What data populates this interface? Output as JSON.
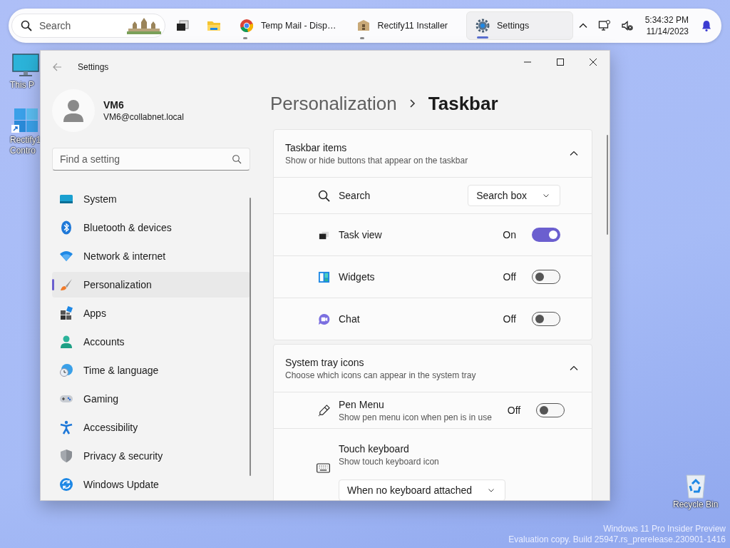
{
  "taskbar": {
    "search": {
      "placeholder": "Search"
    },
    "apps": [
      {
        "kind": "taskview",
        "running": false,
        "selected": false
      },
      {
        "kind": "explorer",
        "running": false,
        "selected": false
      },
      {
        "kind": "chrome",
        "label": "Temp Mail - Disp…",
        "running": true,
        "selected": false
      },
      {
        "kind": "installer",
        "label": "Rectify11 Installer",
        "running": true,
        "selected": false
      },
      {
        "kind": "settings",
        "label": "Settings",
        "running": true,
        "selected": true
      }
    ],
    "clock_time": "5:34:32 PM",
    "clock_date": "11/14/2023"
  },
  "desktop_icons": [
    {
      "kind": "pc",
      "lines": [
        "This P"
      ]
    },
    {
      "kind": "shortcut",
      "lines": [
        "Rectify1",
        "Contro"
      ]
    }
  ],
  "recycle_bin": {
    "label": "Recycle Bin"
  },
  "build_info": [
    "Windows 11 Pro Insider Preview",
    "Evaluation copy. Build 25947.rs_prerelease.230901-1416"
  ],
  "window": {
    "title": "Settings",
    "user": {
      "name": "VM6",
      "email": "VM6@collabnet.local"
    },
    "search": {
      "placeholder": "Find a setting"
    },
    "nav": [
      {
        "kind": "system",
        "label": "System",
        "selected": false
      },
      {
        "kind": "bluetooth",
        "label": "Bluetooth & devices",
        "selected": false
      },
      {
        "kind": "network",
        "label": "Network & internet",
        "selected": false
      },
      {
        "kind": "personalization",
        "label": "Personalization",
        "selected": true
      },
      {
        "kind": "apps",
        "label": "Apps",
        "selected": false
      },
      {
        "kind": "accounts",
        "label": "Accounts",
        "selected": false
      },
      {
        "kind": "time",
        "label": "Time & language",
        "selected": false
      },
      {
        "kind": "gaming",
        "label": "Gaming",
        "selected": false
      },
      {
        "kind": "accessibility",
        "label": "Accessibility",
        "selected": false
      },
      {
        "kind": "privacy",
        "label": "Privacy & security",
        "selected": false
      },
      {
        "kind": "update",
        "label": "Windows Update",
        "selected": false
      }
    ],
    "breadcrumb": [
      "Personalization",
      "Taskbar"
    ],
    "sections": [
      {
        "title": "Taskbar items",
        "subtitle": "Show or hide buttons that appear on the taskbar",
        "expanded": true,
        "rows": [
          {
            "kind": "dropdown",
            "label": "Search",
            "value": "Search box"
          },
          {
            "kind": "toggle",
            "label": "Task view",
            "state": "On",
            "on": true
          },
          {
            "kind": "toggle",
            "label": "Widgets",
            "state": "Off",
            "on": false
          },
          {
            "kind": "toggle",
            "label": "Chat",
            "state": "Off",
            "on": false
          }
        ]
      },
      {
        "title": "System tray icons",
        "subtitle": "Choose which icons can appear in the system tray",
        "expanded": true,
        "rows": [
          {
            "kind": "toggle",
            "label": "Pen Menu",
            "description": "Show pen menu icon when pen is in use",
            "state": "Off",
            "on": false
          },
          {
            "kind": "dropdown_below",
            "label": "Touch keyboard",
            "description": "Show touch keyboard icon",
            "value": "When no keyboard attached"
          }
        ]
      }
    ]
  }
}
